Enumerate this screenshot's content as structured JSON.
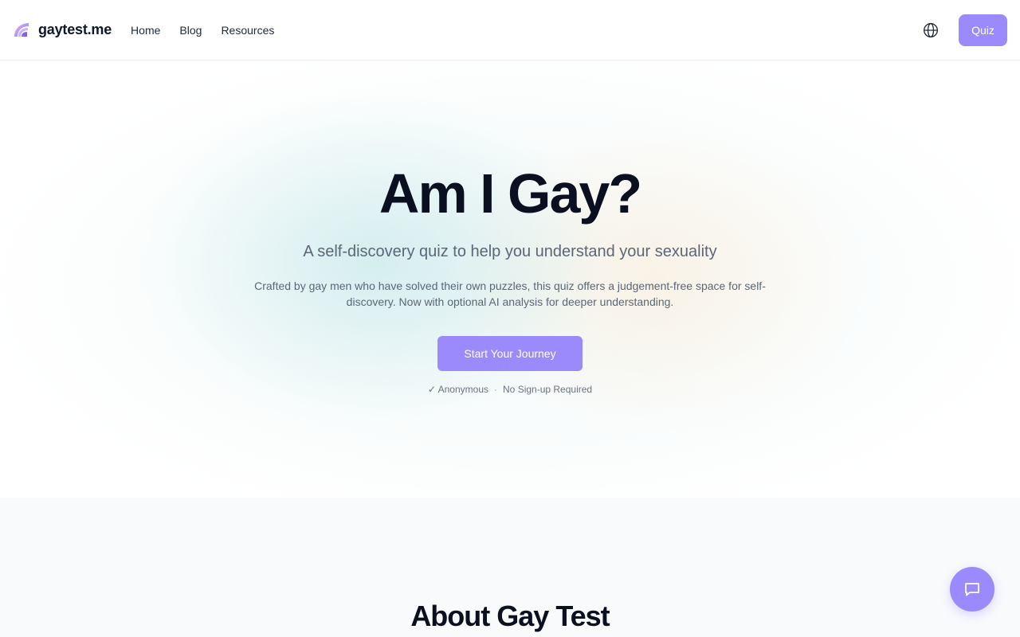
{
  "brand": {
    "name": "gaytest.me"
  },
  "nav": {
    "items": [
      {
        "label": "Home"
      },
      {
        "label": "Blog"
      },
      {
        "label": "Resources"
      }
    ]
  },
  "header": {
    "language_icon": "globe-icon",
    "quiz_label": "Quiz"
  },
  "hero": {
    "title": "Am I Gay?",
    "subtitle": "A self-discovery quiz to help you understand your sexuality",
    "description": "Crafted by gay men who have solved their own puzzles, this quiz offers a judgement-free space for self-discovery. Now with optional AI analysis for deeper understanding.",
    "cta_label": "Start Your Journey",
    "badge_anonymous": "✓ Anonymous",
    "separator": "·",
    "badge_signup": "No Sign-up Required"
  },
  "about": {
    "title": "About Gay Test"
  },
  "chat": {
    "icon": "chat-bubble-icon"
  },
  "colors": {
    "accent": "#9b8afb",
    "text_dark": "#0b1020",
    "text_muted": "#5b6678"
  }
}
